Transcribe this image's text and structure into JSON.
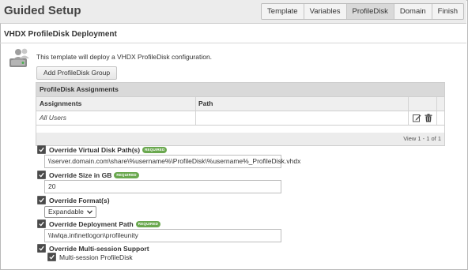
{
  "header": {
    "title": "Guided Setup",
    "tabs": [
      "Template",
      "Variables",
      "ProfileDisk",
      "Domain",
      "Finish"
    ],
    "active_tab": "ProfileDisk"
  },
  "section": {
    "title": "VHDX ProfileDisk Deployment",
    "description": "This template will deploy a VHDX ProfileDisk configuration.",
    "add_button": "Add ProfileDisk Group"
  },
  "grid": {
    "caption": "ProfileDisk Assignments",
    "columns": [
      "Assignments",
      "Path"
    ],
    "rows": [
      {
        "assignment": "All Users",
        "path": ""
      }
    ],
    "pager": "View 1 - 1 of 1"
  },
  "options": {
    "required_badge": "REQUIRED",
    "disk_path": {
      "label": "Override Virtual Disk Path(s)",
      "checked": true,
      "value": "\\\\server.domain.com\\share\\%username%\\ProfileDisk\\%username%_ProfileDisk.vhdx"
    },
    "size": {
      "label": "Override Size in GB",
      "checked": true,
      "value": "20"
    },
    "format": {
      "label": "Override Format(s)",
      "checked": true,
      "value": "Expandable"
    },
    "deployment_path": {
      "label": "Override Deployment Path",
      "checked": true,
      "value": "\\\\lwlqa.int\\netlogon\\profileunity"
    },
    "multisession": {
      "label": "Override Multi-session Support",
      "checked": true,
      "sub_label": "Multi-session ProfileDisk",
      "sub_checked": true
    }
  }
}
